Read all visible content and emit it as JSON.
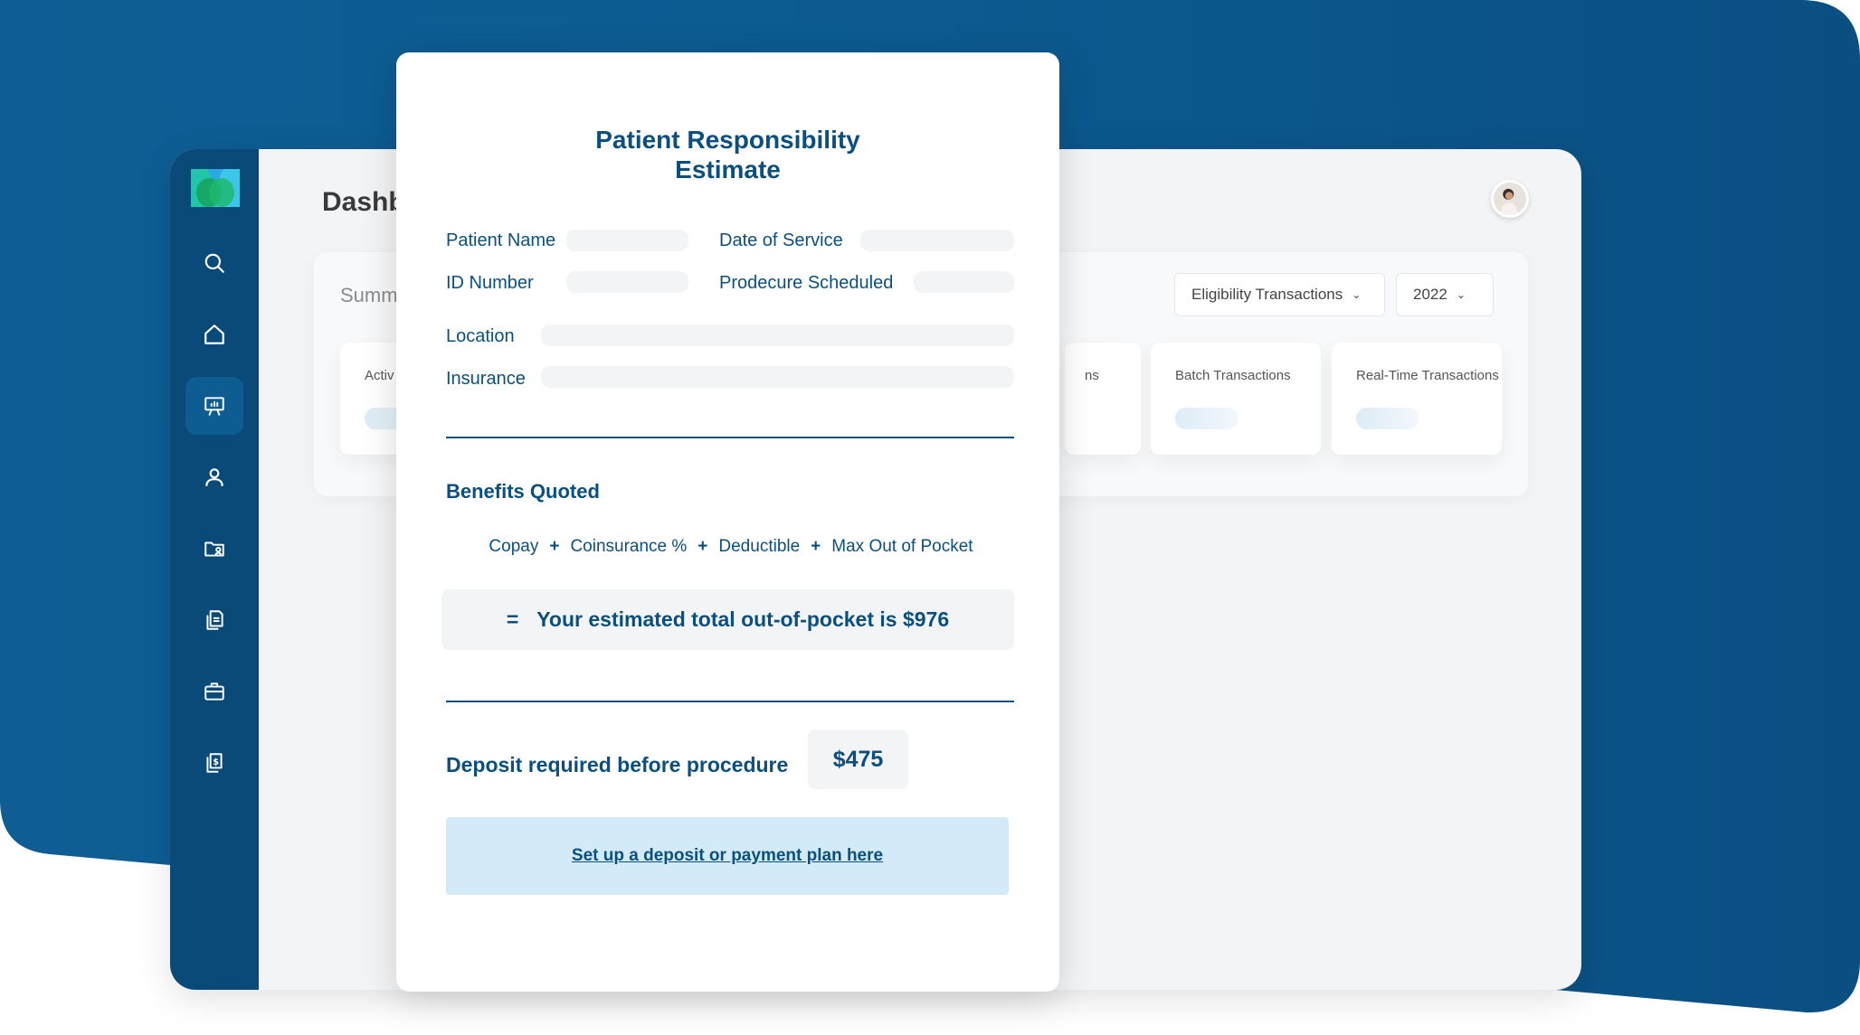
{
  "colors": {
    "brand_dark": "#0a4a78",
    "brand_text": "#0b4f7f",
    "link_bg": "#d3ebf9",
    "field_bg": "#f3f4f6"
  },
  "sidebar": {
    "items": [
      {
        "icon": "search-icon"
      },
      {
        "icon": "home-icon"
      },
      {
        "icon": "presentation-chart-icon",
        "active": true
      },
      {
        "icon": "user-icon"
      },
      {
        "icon": "folder-user-icon"
      },
      {
        "icon": "document-icon"
      },
      {
        "icon": "briefcase-icon"
      },
      {
        "icon": "dollar-document-icon"
      }
    ]
  },
  "dashboard": {
    "title": "Dashb",
    "summary_title": "Summ",
    "dropdowns": {
      "transactions": "Eligibility Transactions",
      "year": "2022"
    },
    "stat_cards": [
      {
        "label": "Activ"
      },
      {
        "label": "ns"
      },
      {
        "label": "Batch Transactions"
      },
      {
        "label": "Real-Time Transactions"
      }
    ]
  },
  "modal": {
    "title_line1": "Patient Responsibility",
    "title_line2": "Estimate",
    "fields": {
      "patient_name": "Patient Name",
      "date_of_service": "Date of Service",
      "id_number": "ID Number",
      "procedure_scheduled": "Prodecure Scheduled",
      "location": "Location",
      "insurance": "Insurance"
    },
    "benefits_title": "Benefits Quoted",
    "formula": {
      "copay": "Copay",
      "coinsurance": "Coinsurance %",
      "deductible": "Deductible",
      "max_oop": "Max Out of Pocket",
      "plus": "+",
      "equals": "="
    },
    "total_text": "Your estimated total out-of-pocket is $976",
    "deposit_label": "Deposit required before procedure",
    "deposit_amount": "$475",
    "plan_link": "Set up a deposit or payment plan here"
  }
}
